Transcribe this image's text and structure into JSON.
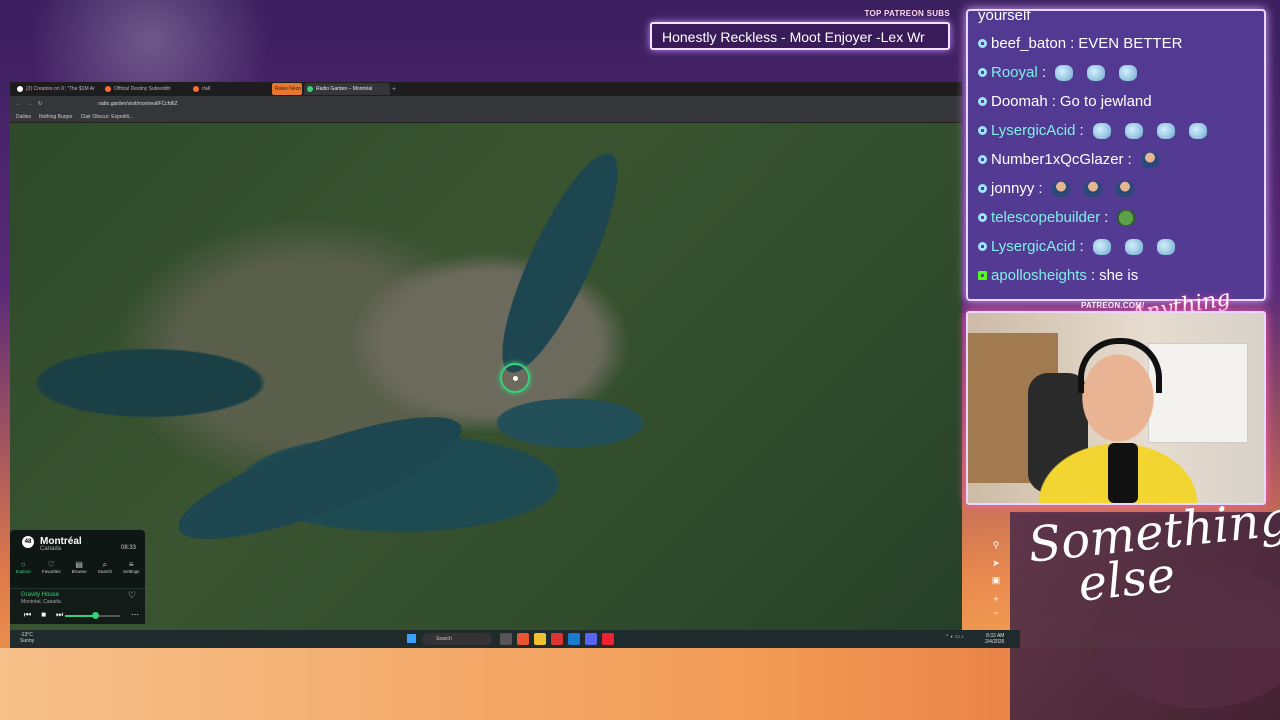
{
  "overlay": {
    "subs_label": "TOP PATREON SUBS",
    "subs_text": "Honestly Reckless - Moot Enjoyer -Lex Wr",
    "patreon_label": "PATREON.COM/",
    "brand_small": "Anything else",
    "brand_logo": "Something else"
  },
  "browser": {
    "tabs": [
      {
        "label": "(2) Creators on X: \"The $1M Ar",
        "active": false
      },
      {
        "label": "Official Destiny Subreddit",
        "active": false
      },
      {
        "label": "r/all",
        "active": false
      },
      {
        "label": "Rolex Neon",
        "active": false
      },
      {
        "label": "Radio Garden – Montréal",
        "active": true
      }
    ],
    "url": "radio.garden/visit/montreal/FCcfd6Z",
    "bookmarks": [
      "Dailies",
      "Nothing Burger",
      "Clair Obscur: Expediti..."
    ]
  },
  "radio_garden": {
    "city": "Montréal",
    "country": "Canada",
    "time": "08:33",
    "badge": "48",
    "nav": [
      {
        "label": "Explore",
        "icon": "globe-icon",
        "glyph": "○",
        "active": true
      },
      {
        "label": "Favorites",
        "icon": "heart-icon",
        "glyph": "♡",
        "active": false
      },
      {
        "label": "Browse",
        "icon": "browse-icon",
        "glyph": "▤",
        "active": false
      },
      {
        "label": "Search",
        "icon": "search-icon",
        "glyph": "⌕",
        "active": false
      },
      {
        "label": "Settings",
        "icon": "settings-icon",
        "glyph": "≡",
        "active": false
      }
    ],
    "player": {
      "station": "Gravity House",
      "location": "Montréal, Canada",
      "volume": 0.55
    }
  },
  "taskbar": {
    "weather_temp": "-13°C",
    "weather_desc": "Sunny",
    "search_placeholder": "Search",
    "time": "8:33 AM",
    "date": "2/4/2026"
  },
  "chat": {
    "messages": [
      {
        "user": "yourself",
        "text": "",
        "partial": true
      },
      {
        "user": "beef_baton",
        "text": "EVEN BETTER",
        "color": "white"
      },
      {
        "user": "Rooyal",
        "text": "",
        "emotes": 3,
        "emote_type": "globe",
        "color": "teal"
      },
      {
        "user": "Doomah",
        "text": "Go to jewland",
        "color": "white"
      },
      {
        "user": "LysergicAcid",
        "text": "",
        "emotes": 4,
        "emote_type": "globe",
        "color": "teal"
      },
      {
        "user": "Number1xQcGlazer",
        "text": "",
        "emotes": 1,
        "emote_type": "person",
        "color": "white"
      },
      {
        "user": "jonnyy",
        "text": "",
        "emotes": 3,
        "emote_type": "person",
        "color": "white"
      },
      {
        "user": "telescopebuilder",
        "text": "",
        "emotes": 1,
        "emote_type": "pepe",
        "color": "teal"
      },
      {
        "user": "LysergicAcid",
        "text": "",
        "emotes": 3,
        "emote_type": "globe",
        "color": "teal"
      },
      {
        "user": "apollosheights",
        "text": "she is",
        "color": "teal",
        "platform": "kick"
      }
    ]
  },
  "colors": {
    "accent_green": "#3ad07a",
    "chat_bg": "#543c96",
    "kick_green": "#53fc18"
  }
}
